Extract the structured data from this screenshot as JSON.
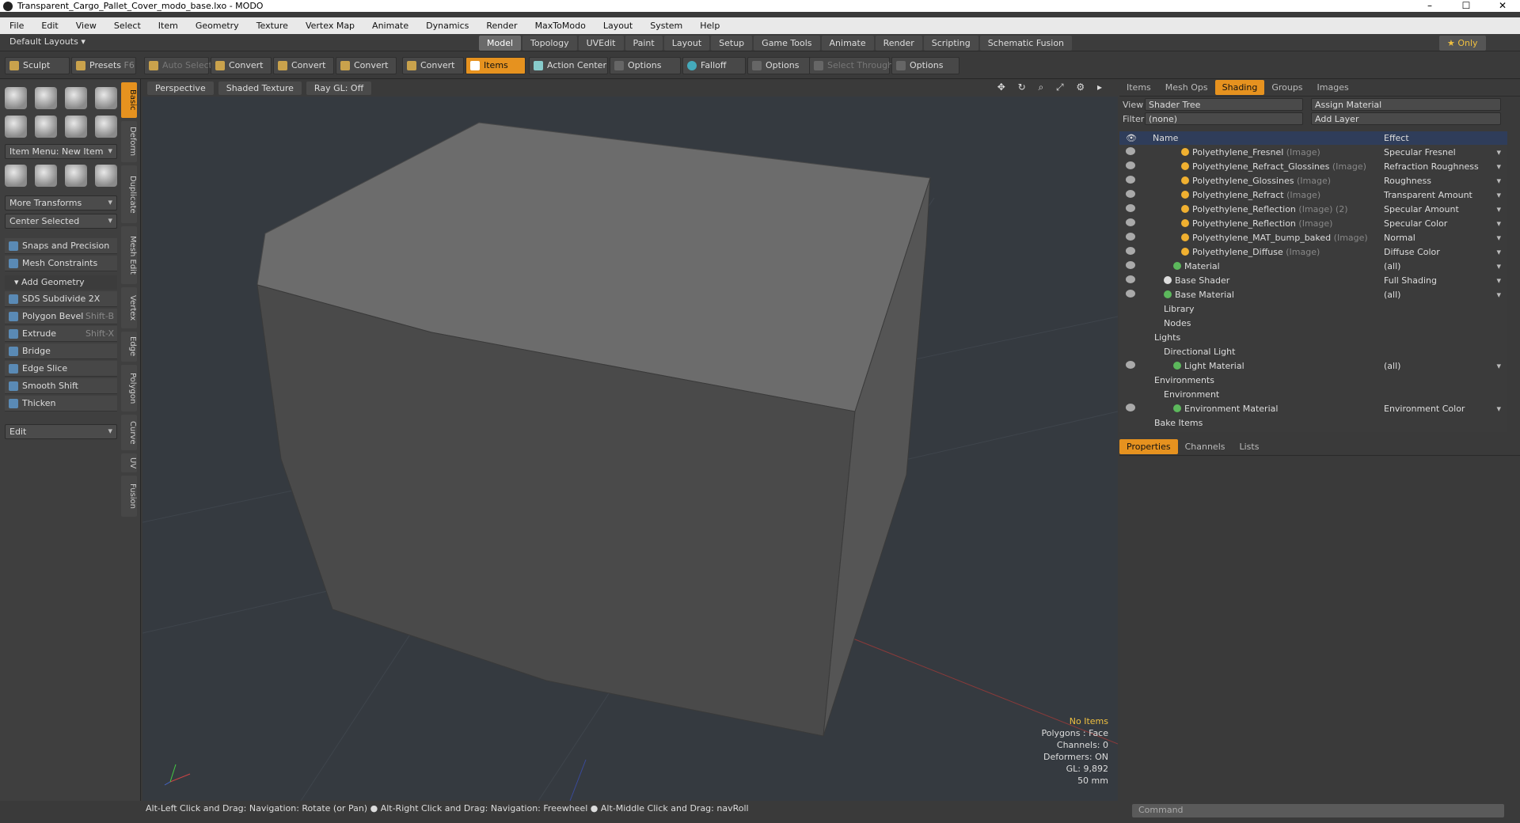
{
  "window": {
    "title": "Transparent_Cargo_Pallet_Cover_modo_base.lxo - MODO"
  },
  "menu": [
    "File",
    "Edit",
    "View",
    "Select",
    "Item",
    "Geometry",
    "Texture",
    "Vertex Map",
    "Animate",
    "Dynamics",
    "Render",
    "MaxToModo",
    "Layout",
    "System",
    "Help"
  ],
  "layout": {
    "default_layouts": "Default Layouts",
    "only": "Only",
    "tabs": [
      "Model",
      "Topology",
      "UVEdit",
      "Paint",
      "Layout",
      "Setup",
      "Game Tools",
      "Animate",
      "Render",
      "Scripting",
      "Schematic Fusion"
    ]
  },
  "toolbar": {
    "sculpt": "Sculpt",
    "presets": "Presets",
    "presets_key": "F6",
    "auto_select": "Auto Select",
    "convert": "Convert",
    "items": "Items",
    "action_center": "Action Center",
    "options": "Options",
    "falloff": "Falloff",
    "select_through": "Select Through"
  },
  "left": {
    "item_menu": "Item Menu: New Item",
    "more_transforms": "More Transforms",
    "center_selected": "Center Selected",
    "snaps": "Snaps and Precision",
    "mesh_constraints": "Mesh Constraints",
    "add_geometry": "Add Geometry",
    "tools": [
      {
        "label": "SDS Subdivide 2X",
        "key": ""
      },
      {
        "label": "Polygon Bevel",
        "key": "Shift-B"
      },
      {
        "label": "Extrude",
        "key": "Shift-X"
      },
      {
        "label": "Bridge",
        "key": ""
      },
      {
        "label": "Edge Slice",
        "key": ""
      },
      {
        "label": "Smooth Shift",
        "key": ""
      },
      {
        "label": "Thicken",
        "key": ""
      }
    ],
    "edit": "Edit",
    "vtabs": [
      "Basic",
      "Deform",
      "Duplicate",
      "Mesh Edit",
      "Vertex",
      "Edge",
      "Polygon",
      "Curve",
      "UV",
      "Fusion"
    ]
  },
  "viewport": {
    "perspective": "Perspective",
    "shading": "Shaded Texture",
    "raygl": "Ray GL: Off",
    "hud": {
      "no_items": "No Items",
      "polygons": "Polygons : Face",
      "channels": "Channels: 0",
      "deformers": "Deformers: ON",
      "gl": "GL: 9,892",
      "focal": "50 mm"
    }
  },
  "status": "Alt-Left Click and Drag: Navigation: Rotate (or Pan) ● Alt-Right Click and Drag: Navigation: Freewheel ● Alt-Middle Click and Drag: navRoll",
  "right": {
    "tabs": [
      "Items",
      "Mesh Ops",
      "Shading",
      "Groups",
      "Images"
    ],
    "view_label": "View",
    "view_value": "Shader Tree",
    "assign_material": "Assign Material",
    "filter_label": "Filter",
    "filter_value": "(none)",
    "add_layer": "Add Layer",
    "col_name": "Name",
    "col_effect": "Effect",
    "rows": [
      {
        "name": "Polyethylene_Fresnel",
        "tag": "(Image)",
        "effect": "Specular Fresnel",
        "indent": 58,
        "ball": "o"
      },
      {
        "name": "Polyethylene_Refract_Glossines",
        "tag": "(Image)",
        "effect": "Refraction Roughness",
        "indent": 58,
        "ball": "o"
      },
      {
        "name": "Polyethylene_Glossines",
        "tag": "(Image)",
        "effect": "Roughness",
        "indent": 58,
        "ball": "o"
      },
      {
        "name": "Polyethylene_Refract",
        "tag": "(Image)",
        "effect": "Transparent Amount",
        "indent": 58,
        "ball": "o"
      },
      {
        "name": "Polyethylene_Reflection",
        "tag": "(Image) (2)",
        "effect": "Specular Amount",
        "indent": 58,
        "ball": "o"
      },
      {
        "name": "Polyethylene_Reflection",
        "tag": "(Image)",
        "effect": "Specular Color",
        "indent": 58,
        "ball": "o"
      },
      {
        "name": "Polyethylene_MAT_bump_baked",
        "tag": "(Image)",
        "effect": "Normal",
        "indent": 58,
        "ball": "o"
      },
      {
        "name": "Polyethylene_Diffuse",
        "tag": "(Image)",
        "effect": "Diffuse Color",
        "indent": 58,
        "ball": "o"
      },
      {
        "name": "Material",
        "tag": "",
        "effect": "(all)",
        "indent": 48,
        "ball": "g"
      },
      {
        "name": "Base Shader",
        "tag": "",
        "effect": "Full Shading",
        "indent": 36,
        "ball": "w"
      },
      {
        "name": "Base Material",
        "tag": "",
        "effect": "(all)",
        "indent": 36,
        "ball": "g"
      },
      {
        "name": "Library",
        "tag": "",
        "effect": "",
        "indent": 36,
        "ball": ""
      },
      {
        "name": "Nodes",
        "tag": "",
        "effect": "",
        "indent": 36,
        "ball": ""
      },
      {
        "name": "Lights",
        "tag": "",
        "effect": "",
        "indent": 24,
        "ball": ""
      },
      {
        "name": "Directional Light",
        "tag": "",
        "effect": "",
        "indent": 36,
        "ball": ""
      },
      {
        "name": "Light Material",
        "tag": "",
        "effect": "(all)",
        "indent": 48,
        "ball": "g"
      },
      {
        "name": "Environments",
        "tag": "",
        "effect": "",
        "indent": 24,
        "ball": ""
      },
      {
        "name": "Environment",
        "tag": "",
        "effect": "",
        "indent": 36,
        "ball": ""
      },
      {
        "name": "Environment Material",
        "tag": "",
        "effect": "Environment Color",
        "indent": 48,
        "ball": "g"
      },
      {
        "name": "Bake Items",
        "tag": "",
        "effect": "",
        "indent": 24,
        "ball": ""
      }
    ],
    "props_tabs": [
      "Properties",
      "Channels",
      "Lists"
    ],
    "command_placeholder": "Command"
  }
}
